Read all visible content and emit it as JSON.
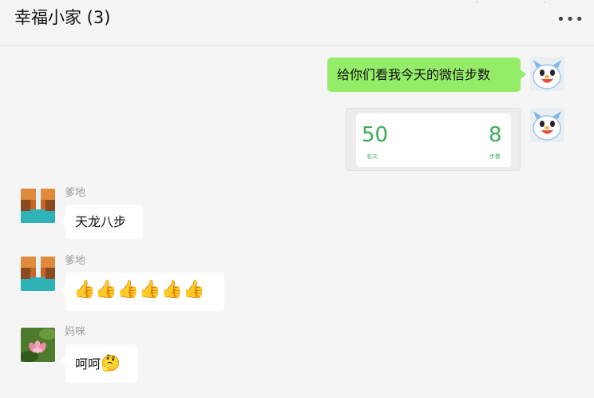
{
  "header": {
    "title": "幸福小家 (3)",
    "more_glyph": "•••"
  },
  "messages": {
    "m1": {
      "text": "给你们看我今天的微信步数"
    },
    "card": {
      "left_value": "50",
      "left_label": "名次",
      "right_value": "8",
      "right_label": "步数"
    },
    "m3": {
      "sender": "爹地",
      "text": "天龙八步"
    },
    "m4": {
      "sender": "爹地",
      "thumbs": [
        "👍",
        "👍",
        "👍",
        "👍",
        "👍",
        "👍"
      ]
    },
    "m5": {
      "sender": "妈咪",
      "text": "呵呵",
      "emoji": "🤔"
    }
  },
  "colors": {
    "my_bubble": "#95ec69",
    "other_bubble": "#ffffff",
    "background": "#f5f5f5",
    "accent_green": "#3dab5a"
  }
}
